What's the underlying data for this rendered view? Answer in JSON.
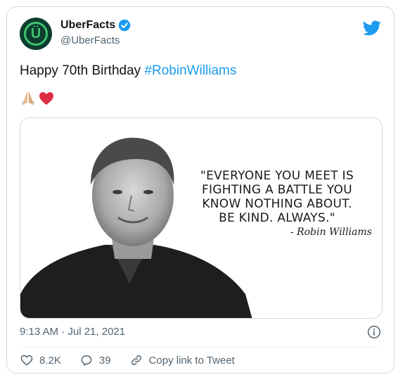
{
  "account": {
    "display_name": "UberFacts",
    "handle": "@UberFacts",
    "avatar_letter": "Ü"
  },
  "tweet": {
    "text": "Happy 70th Birthday ",
    "hashtag": "#RobinWilliams",
    "emojis": [
      "folded-hands-icon",
      "red-heart-icon"
    ]
  },
  "media": {
    "quote_lines": [
      "\"EVERYONE YOU MEET IS",
      "FIGHTING A BATTLE YOU",
      "KNOW NOTHING ABOUT.",
      "BE KIND. ALWAYS.\""
    ],
    "signature": "- Robin Williams"
  },
  "meta": {
    "timestamp": "9:13 AM · Jul 21, 2021"
  },
  "actions": {
    "likes": "8.2K",
    "replies": "39",
    "copy_link": "Copy link to Tweet"
  },
  "colors": {
    "accent": "#1d9bf0",
    "brand_green": "#3fc36b"
  }
}
